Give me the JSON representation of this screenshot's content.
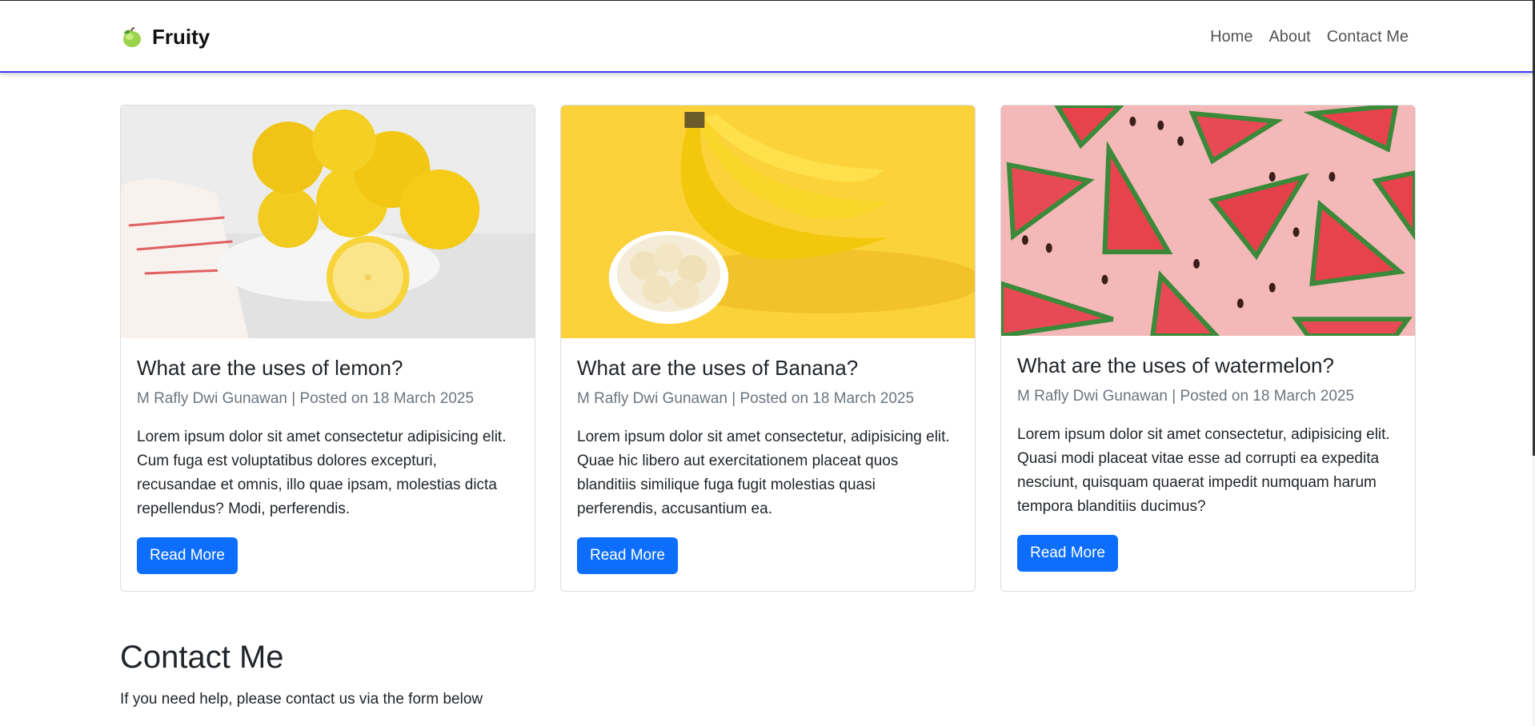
{
  "brand": {
    "name": "Fruity",
    "icon": "apple-icon"
  },
  "nav": {
    "items": [
      {
        "label": "Home"
      },
      {
        "label": "About"
      },
      {
        "label": "Contact Me"
      }
    ]
  },
  "cards": [
    {
      "image": "lemon-image",
      "title": "What are the uses of lemon?",
      "meta": "M Rafly Dwi Gunawan | Posted on 18 March 2025",
      "text": "Lorem ipsum dolor sit amet consectetur adipisicing elit. Cum fuga est voluptatibus dolores excepturi, recusandae et omnis, illo quae ipsam, molestias dicta repellendus? Modi, perferendis.",
      "button": "Read More"
    },
    {
      "image": "banana-image",
      "title": "What are the uses of Banana?",
      "meta": "M Rafly Dwi Gunawan | Posted on 18 March 2025",
      "text": "Lorem ipsum dolor sit amet consectetur, adipisicing elit. Quae hic libero aut exercitationem placeat quos blanditiis similique fuga fugit molestias quasi perferendis, accusantium ea.",
      "button": "Read More"
    },
    {
      "image": "watermelon-image",
      "title": "What are the uses of watermelon?",
      "meta": "M Rafly Dwi Gunawan | Posted on 18 March 2025",
      "text": "Lorem ipsum dolor sit amet consectetur, adipisicing elit. Quasi modi placeat vitae esse ad corrupti ea expedita nesciunt, quisquam quaerat impedit numquam harum tempora blanditiis ducimus?",
      "button": "Read More"
    }
  ],
  "contact": {
    "title": "Contact Me",
    "subtitle": "If you need help, please contact us via the form below"
  },
  "colors": {
    "primary": "#0d6efd",
    "nav_underline": "#3b3bff",
    "watermelon_bg": "#f4b8b8",
    "banana_bg": "#fcd23a"
  }
}
